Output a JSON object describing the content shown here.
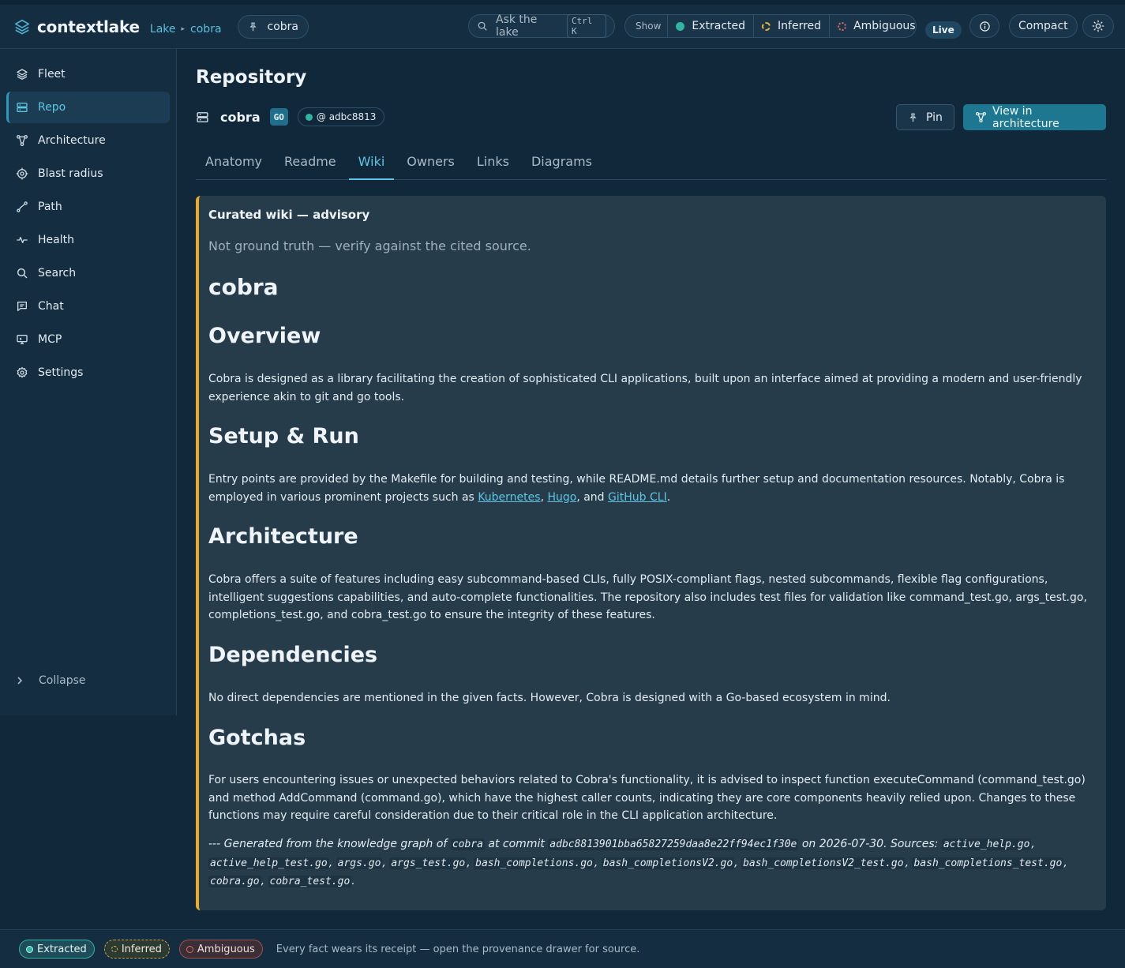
{
  "app": {
    "name": "contextlake",
    "breadcrumb": [
      "Lake",
      "cobra"
    ],
    "repo_chip": "cobra"
  },
  "topbar": {
    "search_placeholder": "Ask the lake",
    "search_shortcut": "Ctrl K",
    "show_label": "Show",
    "filters": [
      "Extracted",
      "Inferred",
      "Ambiguous"
    ],
    "live": "Live",
    "compact": "Compact"
  },
  "sidebar": {
    "items": [
      {
        "label": "Fleet",
        "icon": "layers-icon"
      },
      {
        "label": "Repo",
        "icon": "server-icon",
        "active": true
      },
      {
        "label": "Architecture",
        "icon": "network-icon"
      },
      {
        "label": "Blast radius",
        "icon": "target-icon"
      },
      {
        "label": "Path",
        "icon": "route-icon"
      },
      {
        "label": "Health",
        "icon": "pulse-icon"
      },
      {
        "label": "Search",
        "icon": "search-icon"
      },
      {
        "label": "Chat",
        "icon": "chat-icon"
      },
      {
        "label": "MCP",
        "icon": "monitor-icon"
      },
      {
        "label": "Settings",
        "icon": "gear-icon"
      }
    ],
    "collapse": "Collapse"
  },
  "page": {
    "title": "Repository",
    "repo_name": "cobra",
    "language_badge": "GO",
    "commit": "@ adbc8813",
    "pin_label": "Pin",
    "view_arch_label": "View in architecture",
    "tabs": [
      "Anatomy",
      "Readme",
      "Wiki",
      "Owners",
      "Links",
      "Diagrams"
    ],
    "active_tab": "Wiki"
  },
  "wiki": {
    "advisory_title": "Curated wiki — advisory",
    "advisory_sub": "Not ground truth — verify against the cited source.",
    "heading": "cobra",
    "sections": {
      "overview": {
        "title": "Overview",
        "text": "Cobra is designed as a library facilitating the creation of sophisticated CLI applications, built upon an interface aimed at providing a modern and user-friendly experience akin to git and go tools."
      },
      "setup": {
        "title": "Setup & Run",
        "text_before": "Entry points are provided by the Makefile for building and testing, while README.md details further setup and documentation resources. Notably, Cobra is employed in various prominent projects such as ",
        "links": [
          "Kubernetes",
          "Hugo",
          "GitHub CLI"
        ],
        "sep1": ", ",
        "sep2": ", and ",
        "end": "."
      },
      "architecture": {
        "title": "Architecture",
        "text": "Cobra offers a suite of features including easy subcommand-based CLIs, fully POSIX-compliant flags, nested subcommands, flexible flag configurations, intelligent suggestions capabilities, and auto-complete functionalities. The repository also includes test files for validation like command_test.go, args_test.go, completions_test.go, and cobra_test.go to ensure the integrity of these features."
      },
      "dependencies": {
        "title": "Dependencies",
        "text": "No direct dependencies are mentioned in the given facts. However, Cobra is designed with a Go-based ecosystem in mind."
      },
      "gotchas": {
        "title": "Gotchas",
        "text": "For users encountering issues or unexpected behaviors related to Cobra's functionality, it is advised to inspect function executeCommand (command_test.go) and method AddCommand (command.go), which have the highest caller counts, indicating they are core components heavily relied upon. Changes to these functions may require careful consideration due to their critical role in the CLI application architecture."
      }
    },
    "footer": {
      "prefix": "--- Generated from the knowledge graph of ",
      "repo": "cobra",
      "at_commit": " at commit ",
      "commit_full": "adbc8813901bba65827259daa8e22ff94ec1f30e",
      "on_date": " on 2026-07-30. Sources: ",
      "sources": [
        "active_help.go",
        "active_help_test.go",
        "args.go",
        "args_test.go",
        "bash_completions.go",
        "bash_completionsV2.go",
        "bash_completionsV2_test.go",
        "bash_completions_test.go",
        "cobra.go",
        "cobra_test.go"
      ],
      "end": "."
    }
  },
  "bottombar": {
    "legend": [
      "Extracted",
      "Inferred",
      "Ambiguous"
    ],
    "receipt": "Every fact wears its receipt — open the provenance drawer for source."
  },
  "colors": {
    "accent": "#5dc6e2",
    "advisory_border": "#e7ac2c",
    "extracted": "#2fb5a1",
    "inferred": "#e2b43a",
    "ambiguous": "#e06b5e"
  }
}
